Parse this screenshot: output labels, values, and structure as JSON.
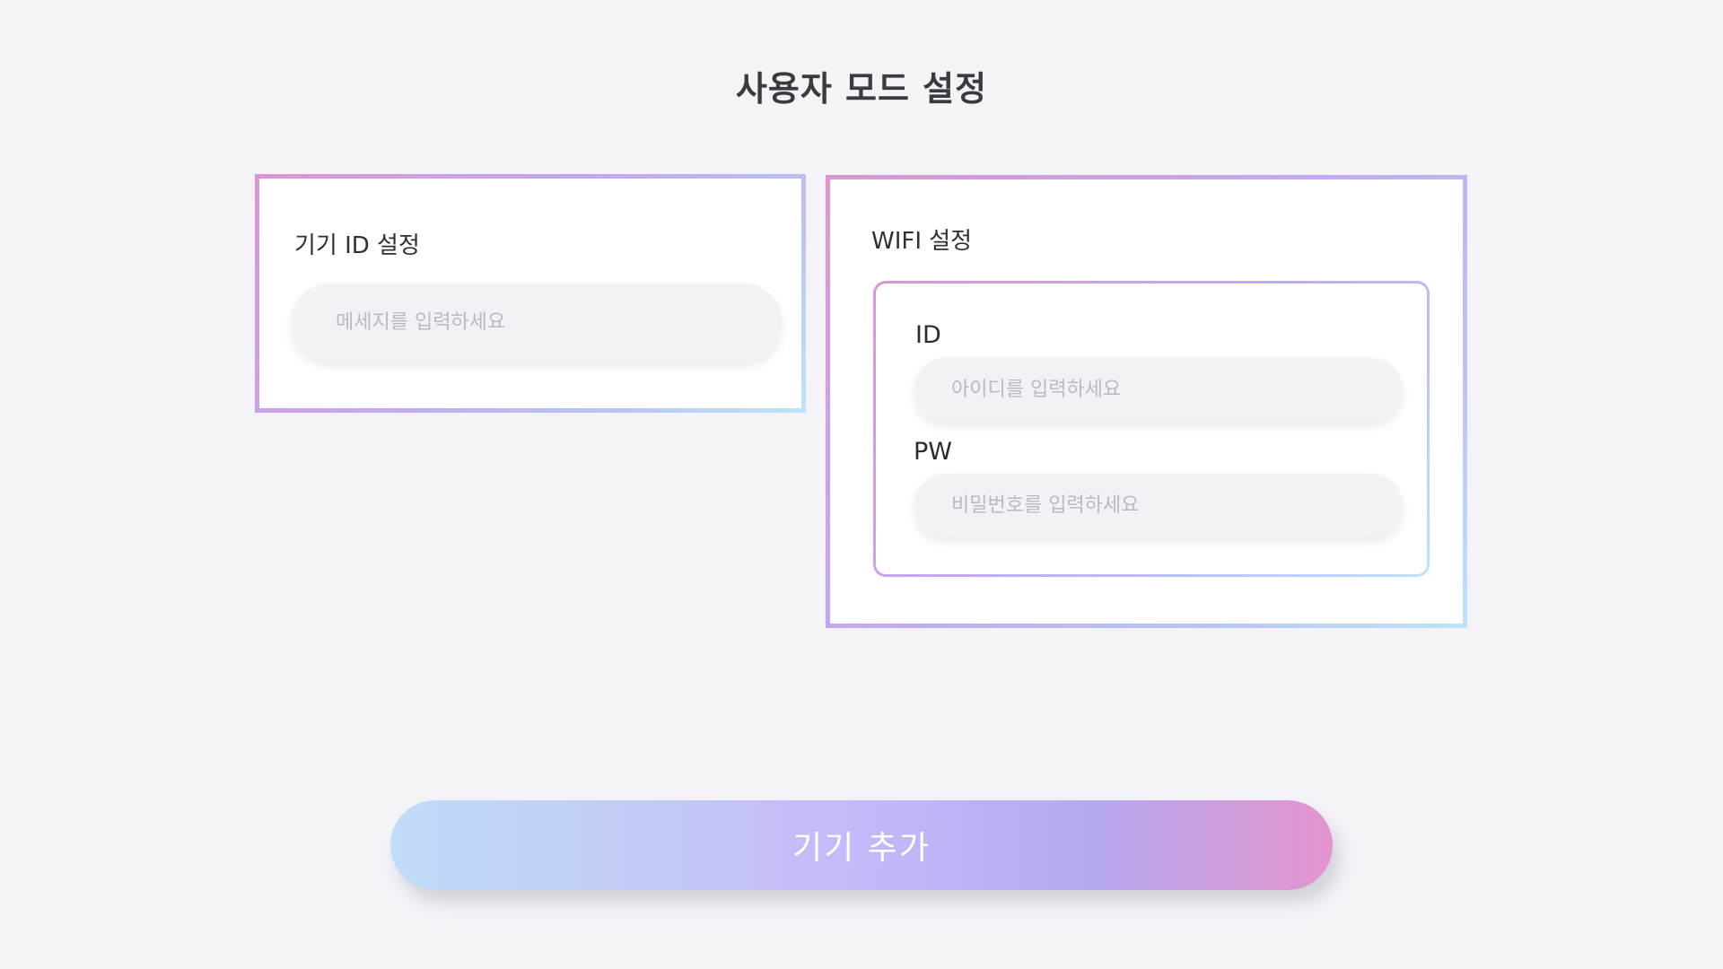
{
  "page": {
    "title": "사용자 모드 설정"
  },
  "device_card": {
    "title": "기기 ID 설정",
    "input_placeholder": "메세지를 입력하세요",
    "input_value": ""
  },
  "wifi_card": {
    "title": "WIFI 설정",
    "id_label": "ID",
    "id_placeholder": "아이디를 입력하세요",
    "id_value": "",
    "pw_label": "PW",
    "pw_placeholder": "비밀번호를 입력하세요",
    "pw_value": ""
  },
  "actions": {
    "add_device_label": "기기 추가"
  },
  "colors": {
    "background": "#f3f3f8",
    "gradient_pink": "#dc96d2",
    "gradient_purple": "#c2a8f3",
    "gradient_blue": "#bfe3f8",
    "input_background": "#f1f1f6"
  }
}
